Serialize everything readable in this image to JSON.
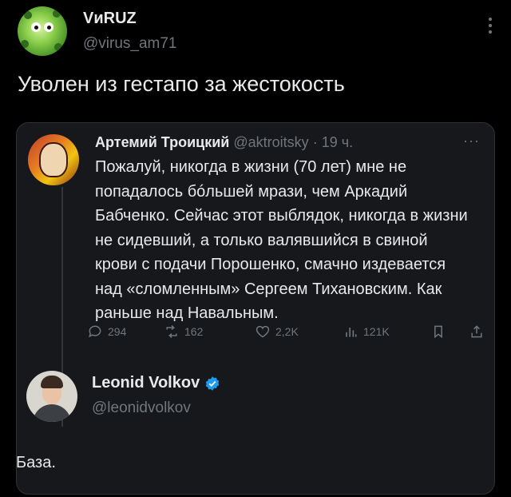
{
  "post": {
    "author_name": "VиRUZ",
    "author_handle": "@virus_am71",
    "text": "Уволен из гестапо за жестокость",
    "avatar_icon": "virus-avatar"
  },
  "quoted": {
    "author_name": "Артемий Троицкий",
    "author_handle": "@aktroitsky",
    "time": "· 19 ч.",
    "body": "Пожалуй, никогда в жизни (70 лет) мне не попадалось бóльшей мрази, чем Аркадий Бабченко. Сейчас этот выблядок, никогда в жизни не сидевший, а только валявшийся в свиной крови с подачи Порошенко, смачно издевается над «сломленным» Сергеем Тихановским. Как раньше над Навальным.",
    "more_label": "···",
    "stats": {
      "replies": "294",
      "reposts": "162",
      "likes": "2,2K",
      "views": "121K"
    }
  },
  "reply": {
    "author_name": "Leonid Volkov",
    "author_handle": "@leonidvolkov",
    "verified_color": "#1d9bf0",
    "text": "База."
  },
  "colors": {
    "background": "#000000",
    "card": "#16181c",
    "text": "#e7e9ea",
    "muted": "#71767b"
  }
}
